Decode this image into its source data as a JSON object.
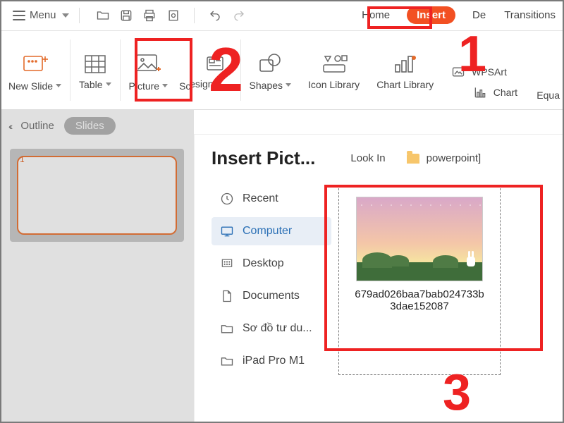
{
  "menubar": {
    "menu_label": "Menu"
  },
  "tabs": {
    "home": "Home",
    "insert": "Insert",
    "design_truncated": "De",
    "transitions": "Transitions"
  },
  "ribbon": {
    "new_slide": "New Slide",
    "table": "Table",
    "picture": "Picture",
    "screenshot_trunc": "Scr",
    "design_trunc": "esign",
    "shapes": "Shapes",
    "icon_library": "Icon Library",
    "chart_library": "Chart Library",
    "wpsart": "WPSArt",
    "chart": "Chart",
    "equation_trunc": "Equa"
  },
  "leftpane": {
    "outline": "Outline",
    "slides": "Slides",
    "slide_number": "1"
  },
  "dialog": {
    "title": "Insert Pict...",
    "lookin_label": "Look In",
    "folder_name": "powerpoint]",
    "places": {
      "recent": "Recent",
      "computer": "Computer",
      "desktop": "Desktop",
      "documents": "Documents",
      "custom1": "Sơ đồ tư du...",
      "custom2": "iPad Pro M1"
    },
    "file": {
      "name_line1": "679ad026baa7bab024733b",
      "name_line2": "3dae152087"
    }
  },
  "callouts": {
    "n1": "1",
    "n2": "2",
    "n3": "3"
  }
}
